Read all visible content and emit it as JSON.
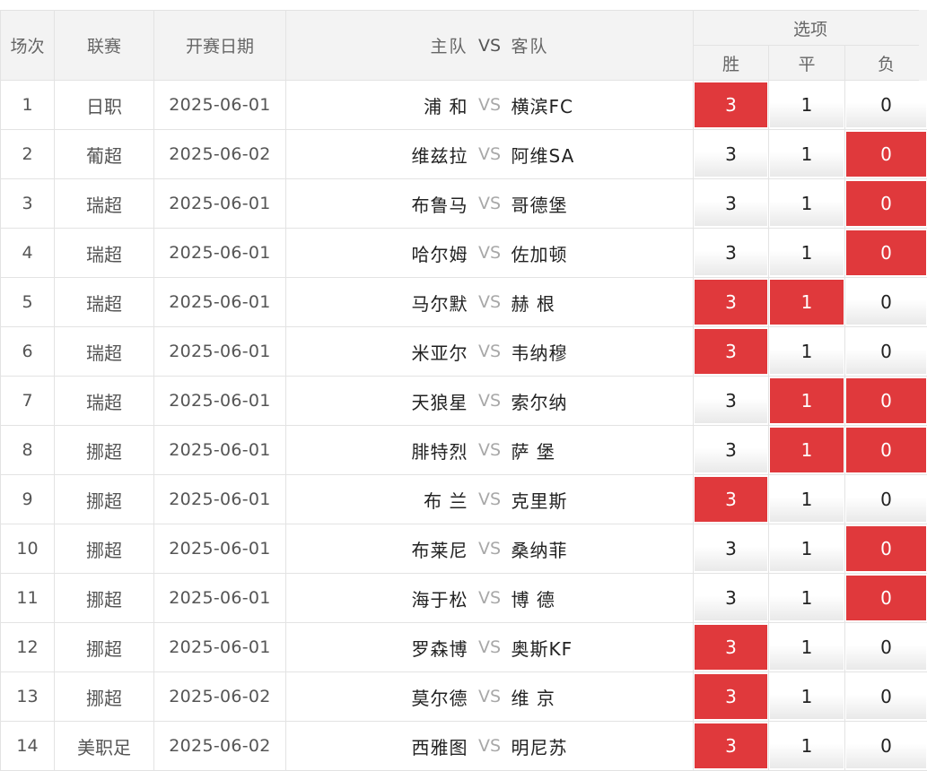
{
  "header": {
    "col_num": "场次",
    "col_league": "联赛",
    "col_date": "开赛日期",
    "col_home": "主队",
    "col_vs": "VS",
    "col_away": "客队",
    "col_options": "选项",
    "opt_win": "胜",
    "opt_draw": "平",
    "opt_lose": "负"
  },
  "colors": {
    "selected": "#e0393c",
    "header_bg": "#f3f3f3",
    "border": "#e3e3e3"
  },
  "rows": [
    {
      "num": "1",
      "league": "日职",
      "date": "2025-06-01",
      "home": "浦 和",
      "vs": "VS",
      "away": "横滨FC",
      "win": "3",
      "draw": "1",
      "lose": "0",
      "sel": [
        true,
        false,
        false
      ]
    },
    {
      "num": "2",
      "league": "葡超",
      "date": "2025-06-02",
      "home": "维兹拉",
      "vs": "VS",
      "away": "阿维SA",
      "win": "3",
      "draw": "1",
      "lose": "0",
      "sel": [
        false,
        false,
        true
      ]
    },
    {
      "num": "3",
      "league": "瑞超",
      "date": "2025-06-01",
      "home": "布鲁马",
      "vs": "VS",
      "away": "哥德堡",
      "win": "3",
      "draw": "1",
      "lose": "0",
      "sel": [
        false,
        false,
        true
      ]
    },
    {
      "num": "4",
      "league": "瑞超",
      "date": "2025-06-01",
      "home": "哈尔姆",
      "vs": "VS",
      "away": "佐加顿",
      "win": "3",
      "draw": "1",
      "lose": "0",
      "sel": [
        false,
        false,
        true
      ]
    },
    {
      "num": "5",
      "league": "瑞超",
      "date": "2025-06-01",
      "home": "马尔默",
      "vs": "VS",
      "away": "赫 根",
      "win": "3",
      "draw": "1",
      "lose": "0",
      "sel": [
        true,
        true,
        false
      ]
    },
    {
      "num": "6",
      "league": "瑞超",
      "date": "2025-06-01",
      "home": "米亚尔",
      "vs": "VS",
      "away": "韦纳穆",
      "win": "3",
      "draw": "1",
      "lose": "0",
      "sel": [
        true,
        false,
        false
      ]
    },
    {
      "num": "7",
      "league": "瑞超",
      "date": "2025-06-01",
      "home": "天狼星",
      "vs": "VS",
      "away": "索尔纳",
      "win": "3",
      "draw": "1",
      "lose": "0",
      "sel": [
        false,
        true,
        true
      ]
    },
    {
      "num": "8",
      "league": "挪超",
      "date": "2025-06-01",
      "home": "腓特烈",
      "vs": "VS",
      "away": "萨 堡",
      "win": "3",
      "draw": "1",
      "lose": "0",
      "sel": [
        false,
        true,
        true
      ]
    },
    {
      "num": "9",
      "league": "挪超",
      "date": "2025-06-01",
      "home": "布 兰",
      "vs": "VS",
      "away": "克里斯",
      "win": "3",
      "draw": "1",
      "lose": "0",
      "sel": [
        true,
        false,
        false
      ]
    },
    {
      "num": "10",
      "league": "挪超",
      "date": "2025-06-01",
      "home": "布莱尼",
      "vs": "VS",
      "away": "桑纳菲",
      "win": "3",
      "draw": "1",
      "lose": "0",
      "sel": [
        false,
        false,
        true
      ]
    },
    {
      "num": "11",
      "league": "挪超",
      "date": "2025-06-01",
      "home": "海于松",
      "vs": "VS",
      "away": "博 德",
      "win": "3",
      "draw": "1",
      "lose": "0",
      "sel": [
        false,
        false,
        true
      ]
    },
    {
      "num": "12",
      "league": "挪超",
      "date": "2025-06-01",
      "home": "罗森博",
      "vs": "VS",
      "away": "奥斯KF",
      "win": "3",
      "draw": "1",
      "lose": "0",
      "sel": [
        true,
        false,
        false
      ]
    },
    {
      "num": "13",
      "league": "挪超",
      "date": "2025-06-02",
      "home": "莫尔德",
      "vs": "VS",
      "away": "维 京",
      "win": "3",
      "draw": "1",
      "lose": "0",
      "sel": [
        true,
        false,
        false
      ]
    },
    {
      "num": "14",
      "league": "美职足",
      "date": "2025-06-02",
      "home": "西雅图",
      "vs": "VS",
      "away": "明尼苏",
      "win": "3",
      "draw": "1",
      "lose": "0",
      "sel": [
        true,
        false,
        false
      ]
    }
  ]
}
